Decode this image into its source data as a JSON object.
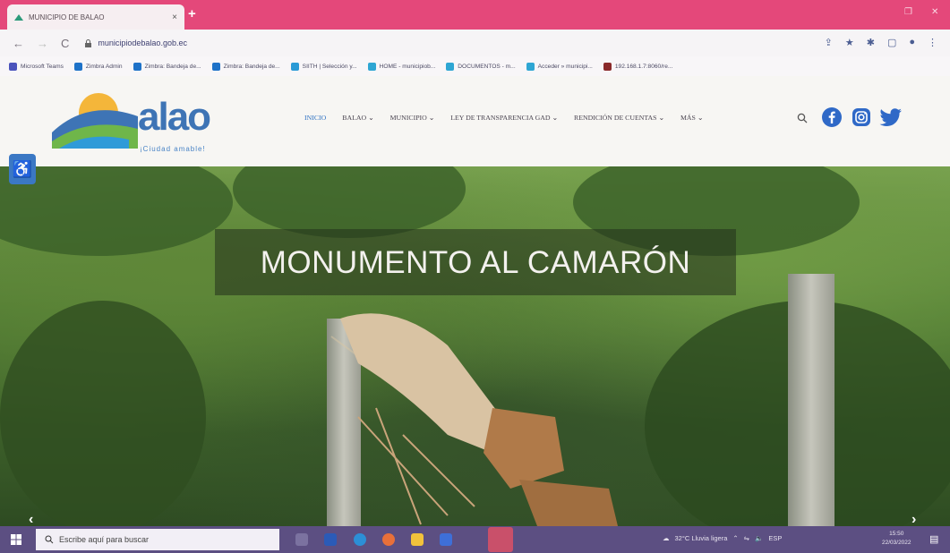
{
  "browser": {
    "tab_title": "MUNICIPIO DE BALAO",
    "tab_close": "×",
    "new_tab": "+",
    "url": "municipiodebalao.gob.ec",
    "nav_back": "←",
    "nav_forward": "→",
    "nav_reload": "C",
    "bookmarks": [
      {
        "label": "Microsoft Teams",
        "color": "#4b53bc"
      },
      {
        "label": "Zimbra Admin",
        "color": "#1e72c8"
      },
      {
        "label": "Zimbra: Bandeja de...",
        "color": "#1e72c8"
      },
      {
        "label": "Zimbra: Bandeja de...",
        "color": "#1e72c8"
      },
      {
        "label": "SIITH | Selección y...",
        "color": "#2a9ad6"
      },
      {
        "label": "HOME - municipiob...",
        "color": "#2ea6d3"
      },
      {
        "label": "DOCUMENTOS - m...",
        "color": "#2ea6d3"
      },
      {
        "label": "Acceder » municipi...",
        "color": "#2ea6d3"
      },
      {
        "label": "192.168.1.7:8060/re...",
        "color": "#8a2a2a"
      }
    ]
  },
  "site": {
    "logo_text": "alao",
    "logo_tagline": "¡Ciudad amable!",
    "menu": [
      {
        "label": "INICIO",
        "active": true
      },
      {
        "label": "BALAO ⌄",
        "active": false
      },
      {
        "label": "MUNICIPIO ⌄",
        "active": false
      },
      {
        "label": "LEY DE TRANSPARENCIA GAD ⌄",
        "active": false
      },
      {
        "label": "RENDICIÓN DE CUENTAS ⌄",
        "active": false
      },
      {
        "label": "MÁS ⌄",
        "active": false
      }
    ],
    "social": [
      {
        "icon": "facebook-icon",
        "color": "#2f69c7"
      },
      {
        "icon": "instagram-icon",
        "color": "#2f69c7"
      },
      {
        "icon": "twitter-icon",
        "color": "#2f69c7"
      }
    ]
  },
  "hero": {
    "title": "MONUMENTO AL CAMARÓN",
    "prev_arrow": "‹",
    "next_arrow": "›"
  },
  "accessibility": {
    "icon": "wheelchair-icon",
    "color": "#3b78c4"
  },
  "taskbar": {
    "search_placeholder": "Escribe aquí para buscar",
    "weather": "32°C Lluvia ligera",
    "language": "ESP",
    "time": "15:50",
    "date": "22/03/2022"
  }
}
